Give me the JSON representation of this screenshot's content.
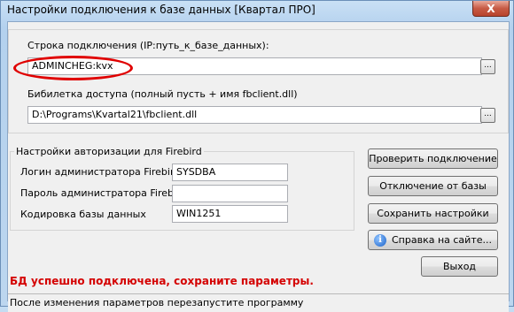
{
  "window": {
    "title": "Настройки подключения к базе данных [Квартал ПРО]",
    "close_glyph": "X"
  },
  "connection": {
    "label": "Строка подключения (IP:путь_к_базе_данных):",
    "value": "ADMINCHEG:kvx",
    "browse_label": "..."
  },
  "library": {
    "label": "Бибилетка доступа (полный пусть + имя fbclient.dll)",
    "value": "D:\\Programs\\Kvartal21\\fbclient.dll",
    "browse_label": "..."
  },
  "auth": {
    "legend": "Настройки авторизации для Firebird",
    "login_label": "Логин администратора Firebird",
    "login_value": "SYSDBA",
    "password_label": "Пароль администратора Firebird",
    "password_value": "",
    "encoding_label": "Кодировка базы данных",
    "encoding_value": "WIN1251"
  },
  "buttons": {
    "check": "Проверить подключение",
    "disconnect": "Отключение от базы",
    "save": "Сохранить настройки",
    "help": "Справка на сайте...",
    "exit": "Выход"
  },
  "messages": {
    "success": "БД успешно подключена, сохраните параметры.",
    "status": "После изменения параметров перезапустите программу"
  },
  "colors": {
    "success_text": "#d40000",
    "highlight_ellipse": "#e00000"
  }
}
